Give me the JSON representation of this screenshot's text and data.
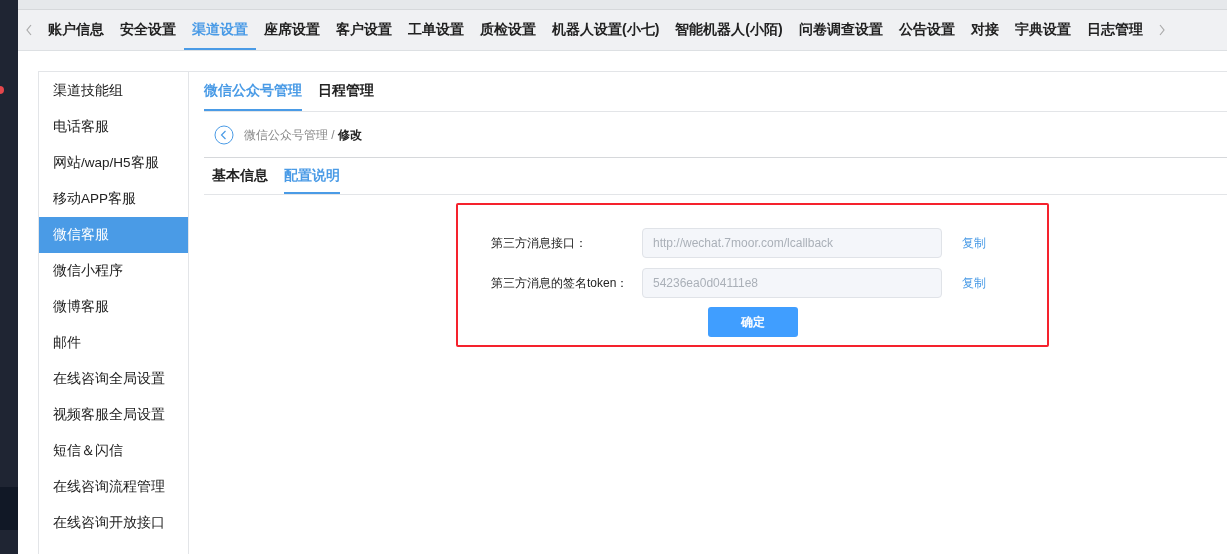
{
  "top_tabs": [
    {
      "label": "账户信息",
      "selected": false
    },
    {
      "label": "安全设置",
      "selected": false
    },
    {
      "label": "渠道设置",
      "selected": true
    },
    {
      "label": "座席设置",
      "selected": false
    },
    {
      "label": "客户设置",
      "selected": false
    },
    {
      "label": "工单设置",
      "selected": false
    },
    {
      "label": "质检设置",
      "selected": false
    },
    {
      "label": "机器人设置(小七)",
      "selected": false
    },
    {
      "label": "智能机器人(小陌)",
      "selected": false
    },
    {
      "label": "问卷调查设置",
      "selected": false
    },
    {
      "label": "公告设置",
      "selected": false
    },
    {
      "label": "对接",
      "selected": false
    },
    {
      "label": "宇典设置",
      "selected": false
    },
    {
      "label": "日志管理",
      "selected": false
    }
  ],
  "sidebar": {
    "items": [
      {
        "label": "渠道技能组",
        "selected": false
      },
      {
        "label": "电话客服",
        "selected": false
      },
      {
        "label": "网站/wap/H5客服",
        "selected": false
      },
      {
        "label": "移动APP客服",
        "selected": false
      },
      {
        "label": "微信客服",
        "selected": true
      },
      {
        "label": "微信小程序",
        "selected": false
      },
      {
        "label": "微博客服",
        "selected": false
      },
      {
        "label": "邮件",
        "selected": false
      },
      {
        "label": "在线咨询全局设置",
        "selected": false
      },
      {
        "label": "视频客服全局设置",
        "selected": false
      },
      {
        "label": "短信＆闪信",
        "selected": false
      },
      {
        "label": "在线咨询流程管理",
        "selected": false
      },
      {
        "label": "在线咨询开放接口",
        "selected": false
      }
    ]
  },
  "sub_tabs": [
    {
      "label": "微信公众号管理",
      "selected": true
    },
    {
      "label": "日程管理",
      "selected": false
    }
  ],
  "breadcrumb": {
    "parent": "微信公众号管理 /",
    "current": "修改"
  },
  "form_tabs": [
    {
      "label": "基本信息",
      "selected": false
    },
    {
      "label": "配置说明",
      "selected": true
    }
  ],
  "form": {
    "fields": [
      {
        "label": "第三方消息接口：",
        "value": "http://wechat.7moor.com/lcallback",
        "action": "复制"
      },
      {
        "label": "第三方消息的签名token：",
        "value": "54236ea0d04111e8",
        "action": "复制"
      }
    ],
    "submit": "确定"
  }
}
